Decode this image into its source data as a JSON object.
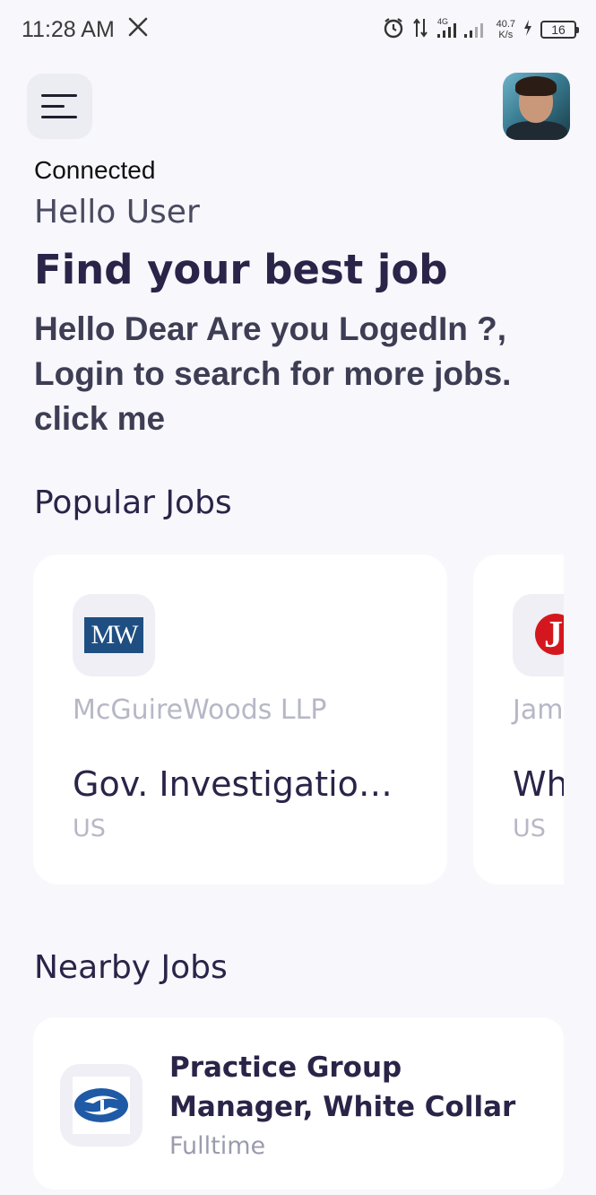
{
  "status_bar": {
    "time": "11:28 AM",
    "x_icon": "x-logo-icon",
    "network": "4G",
    "speed_value": "40.7",
    "speed_unit": "K/s",
    "battery": "16"
  },
  "header": {
    "menu_icon": "hamburger-menu-icon",
    "avatar": "user-avatar"
  },
  "connection_status": "Connected",
  "greeting": "Hello User",
  "headline": "Find your best job",
  "login_prompt": "Hello Dear Are you LogedIn ?, Login to search for more jobs. click me",
  "popular_jobs": {
    "section_title": "Popular Jobs",
    "items": [
      {
        "logo_text": "MW",
        "company": "McGuireWoods LLP",
        "title": "Gov. Investigations & White Collar",
        "location": "US"
      },
      {
        "logo_text": "J",
        "company": "James",
        "title": "White Collar",
        "location": "US"
      }
    ]
  },
  "nearby_jobs": {
    "section_title": "Nearby Jobs",
    "items": [
      {
        "title": "Practice Group Manager, White Collar",
        "type": "Fulltime"
      }
    ]
  },
  "colors": {
    "background": "#f7f7fc",
    "primary_text": "#2a2448",
    "muted_text": "#b7b7c6",
    "mw_logo": "#1f4f82",
    "j_logo": "#d4171e",
    "near_logo": "#1f5aa6"
  }
}
